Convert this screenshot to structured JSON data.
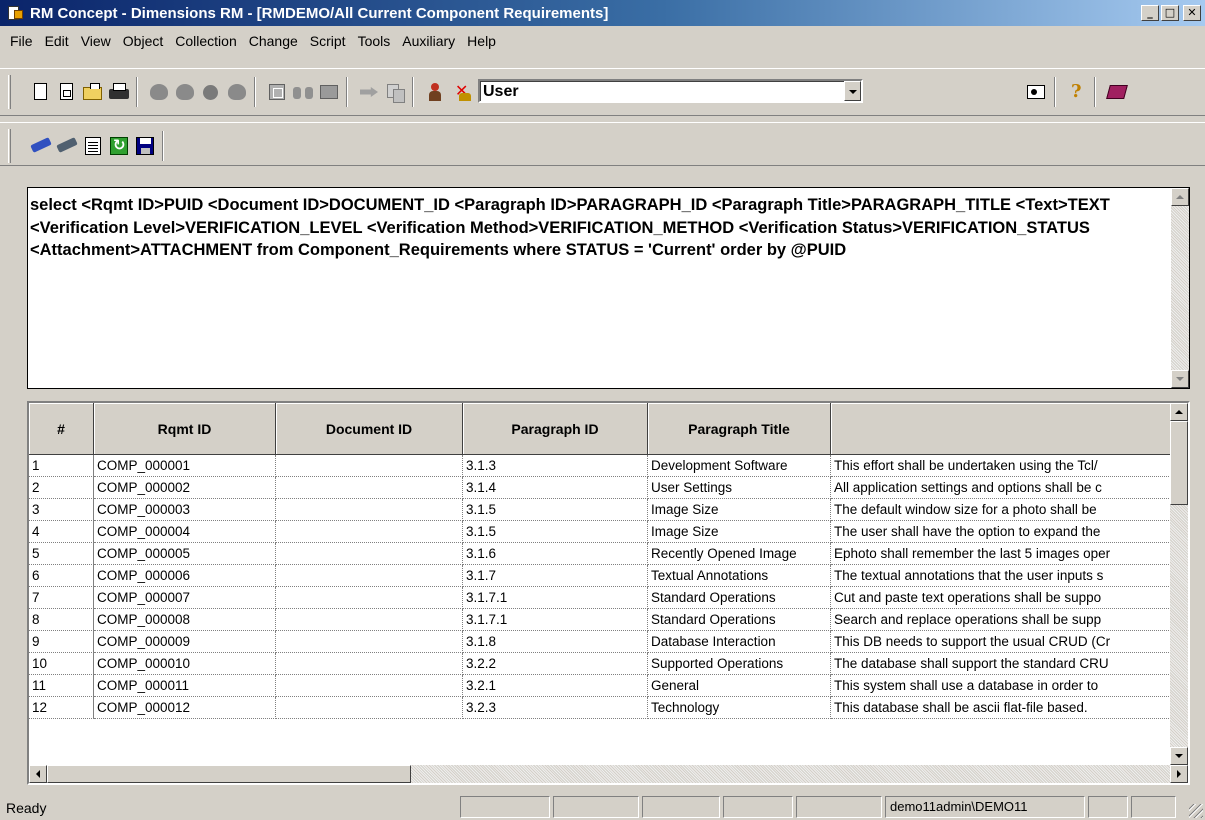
{
  "window": {
    "title": "RM Concept - Dimensions RM - [RMDEMO/All Current Component Requirements]",
    "minimize": "_",
    "maximize": "□",
    "close": "✕"
  },
  "menu": [
    "File",
    "Edit",
    "View",
    "Object",
    "Collection",
    "Change",
    "Script",
    "Tools",
    "Auxiliary",
    "Help"
  ],
  "toolbar": {
    "icons": [
      "new-document-icon",
      "new-document-alt-icon",
      "open-folder-icon",
      "print-icon",
      "object-gray-icon",
      "object-gray-icon",
      "object-gray-icon",
      "object-gray-icon",
      "grid-icon",
      "binoculars-icon",
      "table-icon",
      "forward-icon",
      "copy-icon",
      "add-user-icon",
      "remove-user-icon",
      "login-icon",
      "help-icon",
      "book-icon"
    ],
    "combo_value": "User"
  },
  "toolbar2": {
    "icons": [
      "edit-pencil-icon",
      "edit-pencil-icon",
      "report-icon",
      "refresh-icon",
      "save-icon"
    ]
  },
  "query": {
    "text": "select  <Rqmt ID>PUID <Document ID>DOCUMENT_ID <Paragraph ID>PARAGRAPH_ID <Paragraph Title>PARAGRAPH_TITLE <Text>TEXT <Verification Level>VERIFICATION_LEVEL <Verification Method>VERIFICATION_METHOD <Verification Status>VERIFICATION_STATUS <Attachment>ATTACHMENT from Component_Requirements where STATUS = 'Current'   order by @PUID"
  },
  "grid": {
    "columns": [
      "#",
      "Rqmt ID",
      "Document ID",
      "Paragraph ID",
      "Paragraph Title",
      ""
    ],
    "rows": [
      [
        "1",
        "COMP_000001",
        "",
        "3.1.3",
        "Development Software",
        "This effort shall be undertaken using the Tcl/"
      ],
      [
        "2",
        "COMP_000002",
        "",
        "3.1.4",
        "User Settings",
        "All application settings and options shall be c"
      ],
      [
        "3",
        "COMP_000003",
        "",
        "3.1.5",
        "Image Size",
        "The default window size for a photo shall be"
      ],
      [
        "4",
        "COMP_000004",
        "",
        "3.1.5",
        "Image Size",
        "The user shall have the option to expand the"
      ],
      [
        "5",
        "COMP_000005",
        "",
        "3.1.6",
        "Recently Opened Image",
        "Ephoto shall remember the last 5 images oper"
      ],
      [
        "6",
        "COMP_000006",
        "",
        "3.1.7",
        "Textual Annotations",
        "The textual annotations that the user inputs s"
      ],
      [
        "7",
        "COMP_000007",
        "",
        "3.1.7.1",
        "Standard Operations",
        "Cut and paste text operations shall be suppo"
      ],
      [
        "8",
        "COMP_000008",
        "",
        "3.1.7.1",
        "Standard Operations",
        "Search and replace operations shall be supp"
      ],
      [
        "9",
        "COMP_000009",
        "",
        "3.1.8",
        "Database Interaction",
        "This DB needs to support the usual CRUD (Cr"
      ],
      [
        "10",
        "COMP_000010",
        "",
        "3.2.2",
        "Supported Operations",
        "The database shall support the standard CRU"
      ],
      [
        "11",
        "COMP_000011",
        "",
        "3.2.1",
        "General",
        "This system shall use a database in order to"
      ],
      [
        "12",
        "COMP_000012",
        "",
        "3.2.3",
        "Technology",
        "This database shall be ascii flat-file based."
      ]
    ]
  },
  "status": {
    "text": "Ready",
    "user": "demo11admin\\DEMO11"
  }
}
